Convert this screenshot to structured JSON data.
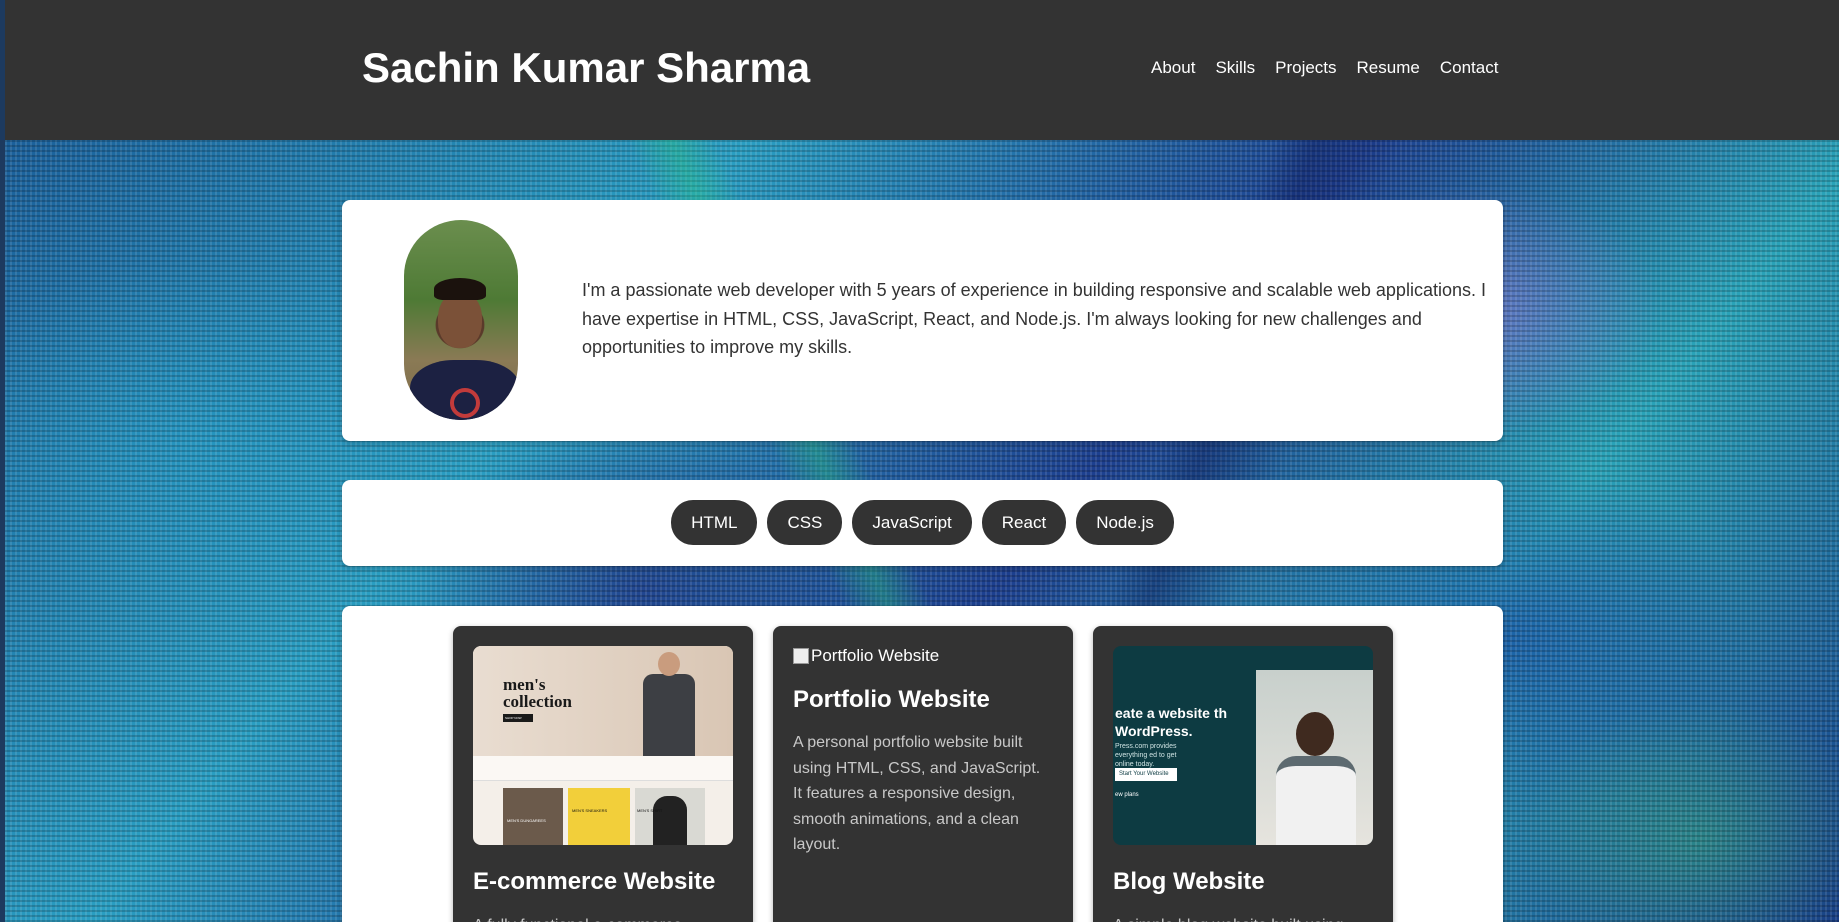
{
  "header": {
    "site_title": "Sachin Kumar Sharma",
    "nav": [
      "About",
      "Skills",
      "Projects",
      "Resume",
      "Contact"
    ]
  },
  "about": {
    "text": "I'm a passionate web developer with 5 years of experience in building responsive and scalable web applications. I have expertise in HTML, CSS, JavaScript, React, and Node.js. I'm always looking for new challenges and opportunities to improve my skills."
  },
  "skills": [
    "HTML",
    "CSS",
    "JavaScript",
    "React",
    "Node.js"
  ],
  "projects": [
    {
      "title": "E-commerce Website",
      "description": "A fully functional e-commerce",
      "thumb": {
        "heading": "men's collection",
        "button": "SHOP NOW",
        "categories": [
          "MEN'S DUNGAREES",
          "MEN'S SNEAKERS",
          "MEN'S SHIRT"
        ]
      }
    },
    {
      "title": "Portfolio Website",
      "image_alt": "Portfolio Website",
      "description": "A personal portfolio website built using HTML, CSS, and JavaScript. It features a responsive design, smooth animations, and a clean layout."
    },
    {
      "title": "Blog Website",
      "description": "A simple blog website built using",
      "thumb": {
        "heading": "eate a website th WordPress.",
        "sub": "Press.com provides everything ed to get online today.",
        "button": "Start Your Website",
        "link": "ew plans"
      }
    }
  ],
  "colors": {
    "header_bg": "#333333",
    "card_bg": "#ffffff",
    "chip_bg": "#333333",
    "text": "#333333"
  }
}
